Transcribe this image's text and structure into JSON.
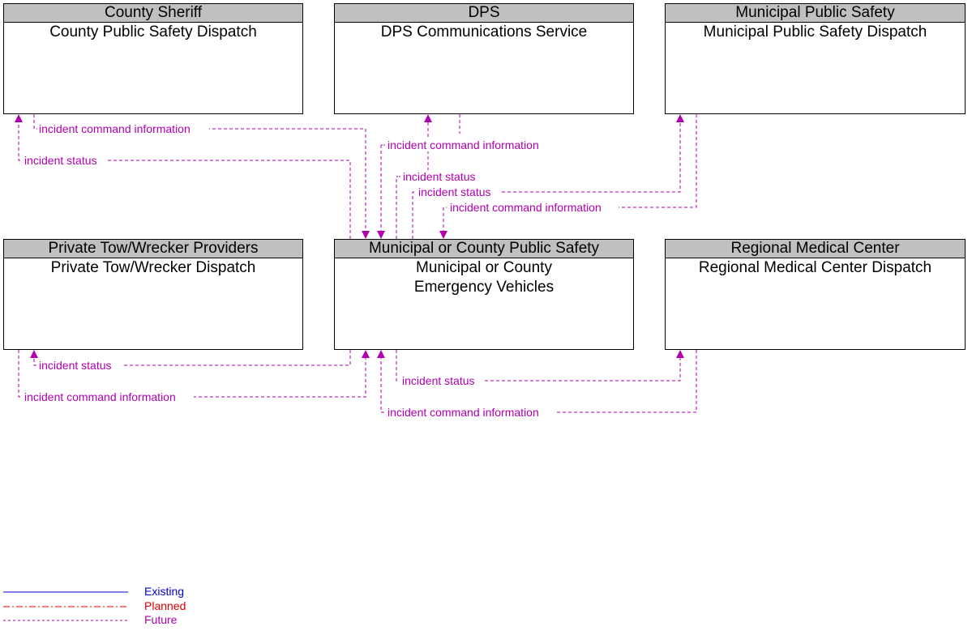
{
  "colors": {
    "future": "#b000b0",
    "existing": "#0000cc",
    "planned": "#e00000",
    "header_bg": "#c0c0c0"
  },
  "boxes": [
    {
      "id": "county-sheriff",
      "owner": "County Sheriff",
      "name": "County Public Safety Dispatch"
    },
    {
      "id": "dps",
      "owner": "DPS",
      "name": "DPS Communications Service"
    },
    {
      "id": "municipal-public-safety",
      "owner": "Municipal Public Safety",
      "name": "Municipal Public Safety Dispatch"
    },
    {
      "id": "private-tow",
      "owner": "Private Tow/Wrecker Providers",
      "name": "Private Tow/Wrecker Dispatch"
    },
    {
      "id": "center",
      "owner": "Municipal or County Public Safety",
      "name": "Municipal or County Emergency Vehicles"
    },
    {
      "id": "regional-medical",
      "owner": "Regional Medical Center",
      "name": "Regional Medical Center Dispatch"
    }
  ],
  "flows": [
    {
      "label": "incident command information",
      "from": "County Public Safety Dispatch",
      "to": "Municipal or County Emergency Vehicles",
      "status": "Future"
    },
    {
      "label": "incident status",
      "from": "Municipal or County Emergency Vehicles",
      "to": "County Public Safety Dispatch",
      "status": "Future"
    },
    {
      "label": "incident command information",
      "from": "DPS Communications Service",
      "to": "Municipal or County Emergency Vehicles",
      "status": "Future"
    },
    {
      "label": "incident status",
      "from": "Municipal or County Emergency Vehicles",
      "to": "DPS Communications Service",
      "status": "Future"
    },
    {
      "label": "incident status",
      "from": "Municipal or County Emergency Vehicles",
      "to": "Municipal Public Safety Dispatch",
      "status": "Future"
    },
    {
      "label": "incident command information",
      "from": "Municipal Public Safety Dispatch",
      "to": "Municipal or County Emergency Vehicles",
      "status": "Future"
    },
    {
      "label": "incident status",
      "from": "Municipal or County Emergency Vehicles",
      "to": "Private Tow/Wrecker Dispatch",
      "status": "Future"
    },
    {
      "label": "incident command information",
      "from": "Private Tow/Wrecker Dispatch",
      "to": "Municipal or County Emergency Vehicles",
      "status": "Future"
    },
    {
      "label": "incident status",
      "from": "Municipal or County Emergency Vehicles",
      "to": "Regional Medical Center Dispatch",
      "status": "Future"
    },
    {
      "label": "incident command information",
      "from": "Regional Medical Center Dispatch",
      "to": "Municipal or County Emergency Vehicles",
      "status": "Future"
    }
  ],
  "legend": [
    {
      "label": "Existing",
      "color": "#0000cc"
    },
    {
      "label": "Planned",
      "color": "#e00000"
    },
    {
      "label": "Future",
      "color": "#b000b0"
    }
  ]
}
